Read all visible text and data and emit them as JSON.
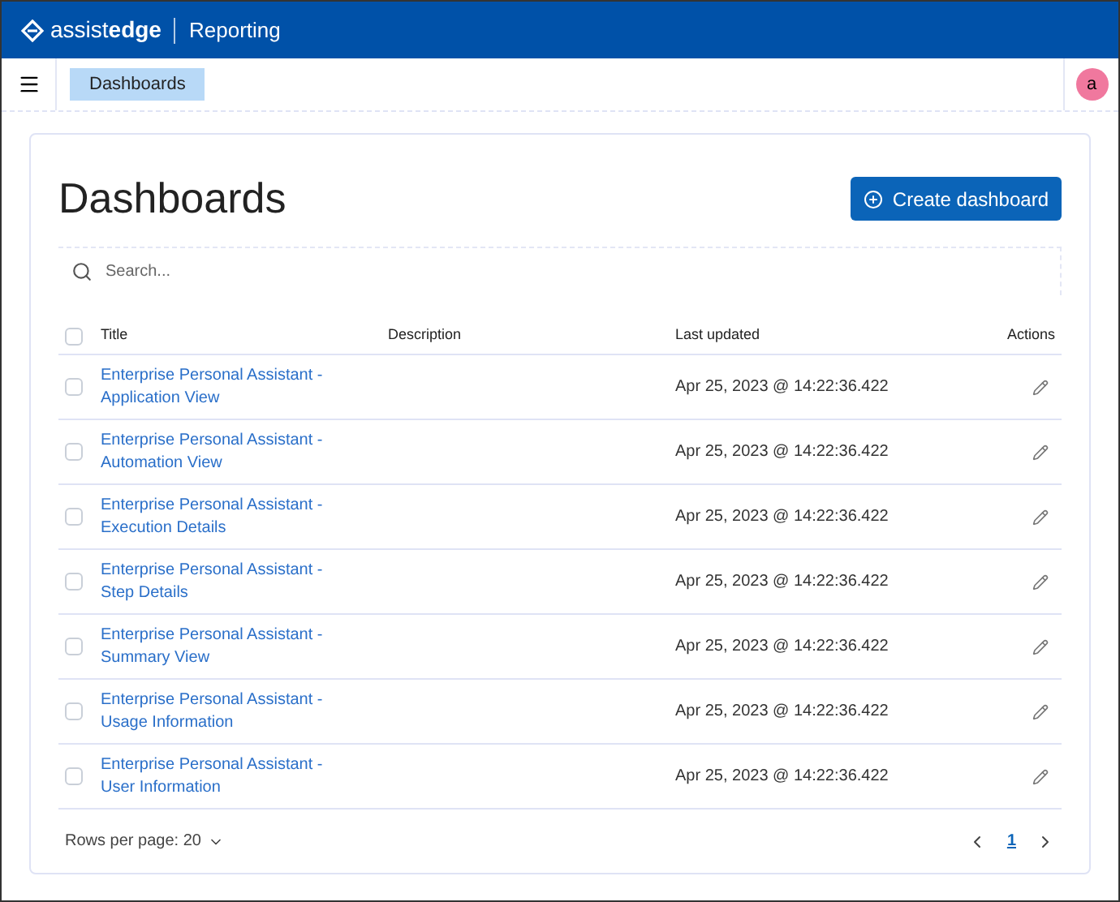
{
  "header": {
    "logo": "assist**edge**",
    "product": "Reporting"
  },
  "nav": {
    "breadcrumb": "Dashboards",
    "avatar": "a"
  },
  "page": {
    "title": "Dashboards",
    "create_button": "Create dashboard"
  },
  "search": {
    "placeholder": "Search..."
  },
  "table": {
    "columns": [
      "Title",
      "Description",
      "Last updated",
      "Actions"
    ],
    "select_all_checked": false,
    "rows": [
      {
        "title": "Enterprise Personal Assistant - Application View",
        "updated": "Apr 25, 2023 @ 14:22:36.422",
        "checked": false
      },
      {
        "title": "Enterprise Personal Assistant - Automation View",
        "updated": "Apr 25, 2023 @ 14:22:36.422",
        "checked": false
      },
      {
        "title": "Enterprise Personal Assistant - Execution Details",
        "updated": "Apr 25, 2023 @ 14:22:36.422",
        "checked": false
      },
      {
        "title": "Enterprise Personal Assistant - Step Details",
        "updated": "Apr 25, 2023 @ 14:22:36.422",
        "checked": false
      },
      {
        "title": "Enterprise Personal Assistant - Summary View",
        "updated": "Apr 25, 2023 @ 14:22:36.422",
        "checked": false
      },
      {
        "title": "Enterprise Personal Assistant - Usage Information",
        "updated": "Apr 25, 2023 @ 14:22:36.422",
        "checked": false
      },
      {
        "title": "Enterprise Personal Assistant - User Information",
        "updated": "Apr 25, 2023 @ 14:22:36.422",
        "checked": false
      }
    ]
  },
  "footer": {
    "rows_per_page": "Rows per page: 20",
    "pages": [
      {
        "label": "1",
        "selected": true
      }
    ]
  }
}
